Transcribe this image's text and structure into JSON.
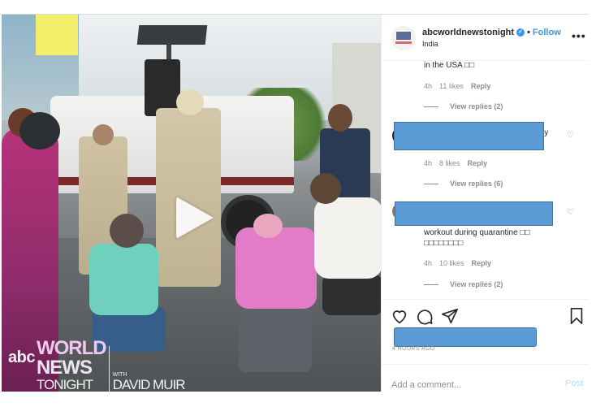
{
  "post": {
    "username": "abcworldnewstonight",
    "verified": true,
    "separator": "•",
    "follow_label": "Follow",
    "location": "India",
    "more_icon": "more-horizontal-icon",
    "more_label": "•••"
  },
  "video": {
    "play_icon": "play-icon",
    "watermark": {
      "network": "abc",
      "line1": "WORLD",
      "line2": "NEWS",
      "line3": "TONIGHT",
      "with": "WITH",
      "anchor": "DAVID MUIR"
    }
  },
  "comments": [
    {
      "text": "in the USA □□",
      "time": "4h",
      "likes": "11 likes",
      "reply_label": "Reply",
      "view_replies": "View replies (2)",
      "redacted": false
    },
    {
      "text_tail": "ly",
      "time": "4h",
      "likes": "8 likes",
      "reply_label": "Reply",
      "view_replies": "View replies (6)",
      "redacted": true
    },
    {
      "text": "workout during quarantine □□",
      "text2": "□□□□□□□□",
      "time": "4h",
      "likes": "10 likes",
      "reply_label": "Reply",
      "view_replies": "View replies (2)",
      "redacted": true
    }
  ],
  "actions": {
    "like_icon": "heart-icon",
    "comment_icon": "comment-icon",
    "share_icon": "share-icon",
    "save_icon": "bookmark-icon",
    "timestamp": "4 HOURS AGO"
  },
  "add_comment": {
    "placeholder": "Add a comment...",
    "post_label": "Post"
  },
  "colors": {
    "link_blue": "#3897f0",
    "post_disabled": "#b2dffc",
    "redaction": "#5b9bd5",
    "muted_text": "#8e8e8e",
    "text": "#262626"
  }
}
